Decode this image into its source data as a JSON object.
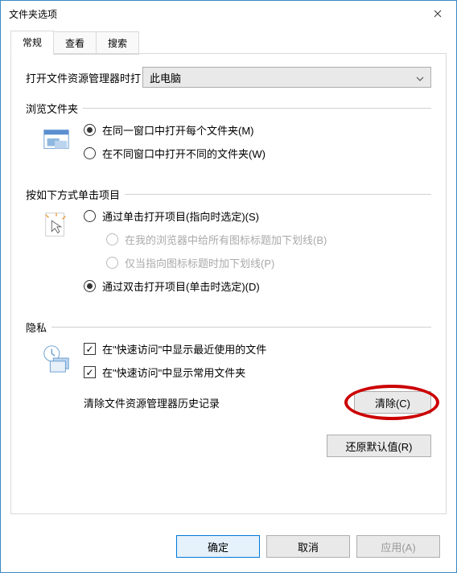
{
  "title": "文件夹选项",
  "tabs": {
    "general": "常规",
    "view": "查看",
    "search": "搜索"
  },
  "row1": {
    "label": "打开文件资源管理器时打",
    "selected": "此电脑"
  },
  "browse": {
    "title": "浏览文件夹",
    "opt1": "在同一窗口中打开每个文件夹(M)",
    "opt2": "在不同窗口中打开不同的文件夹(W)"
  },
  "click": {
    "title": "按如下方式单击项目",
    "opt1": "通过单击打开项目(指向时选定)(S)",
    "opt1a": "在我的浏览器中给所有图标标题加下划线(B)",
    "opt1b": "仅当指向图标标题时加下划线(P)",
    "opt2": "通过双击打开项目(单击时选定)(D)"
  },
  "privacy": {
    "title": "隐私",
    "chk1": "在\"快速访问\"中显示最近使用的文件",
    "chk2": "在\"快速访问\"中显示常用文件夹",
    "clear_label": "清除文件资源管理器历史记录",
    "clear_btn": "清除(C)"
  },
  "restore": "还原默认值(R)",
  "footer": {
    "ok": "确定",
    "cancel": "取消",
    "apply": "应用(A)"
  }
}
